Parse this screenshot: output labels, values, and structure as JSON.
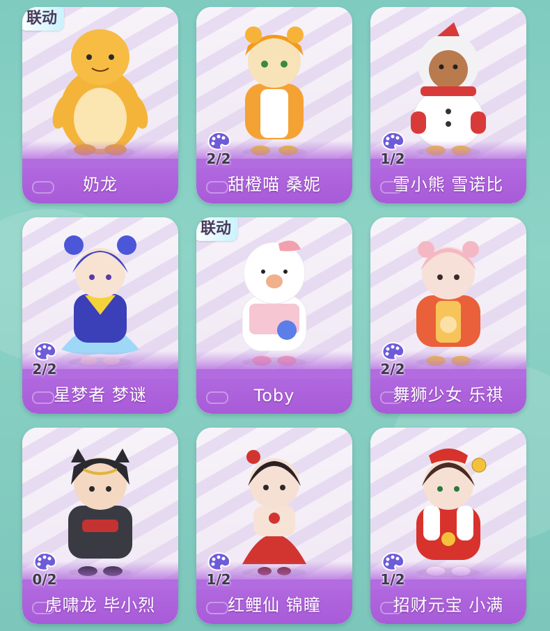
{
  "cards": [
    {
      "name": "奶龙",
      "badge": "联动",
      "count": "",
      "figure": "yellow-dragon",
      "colors": {
        "main": "#f4b43a",
        "belly": "#fbe5b0"
      }
    },
    {
      "name": "甜橙喵 桑妮",
      "badge": "",
      "count": "2/2",
      "figure": "orange-cat-girl",
      "colors": {
        "main": "#f4a233",
        "belly": "#ffffff"
      }
    },
    {
      "name": "雪小熊 雪诺比",
      "badge": "",
      "count": "1/2",
      "figure": "snow-bear",
      "colors": {
        "main": "#ffffff",
        "belly": "#d83a3a"
      }
    },
    {
      "name": "星梦者 梦谜",
      "badge": "",
      "count": "2/2",
      "figure": "star-dreamer",
      "colors": {
        "main": "#3b3fb8",
        "belly": "#9fd8f7"
      }
    },
    {
      "name": "Toby",
      "badge": "联动",
      "count": "",
      "figure": "toby-duck",
      "colors": {
        "main": "#ffffff",
        "belly": "#f6c6d2"
      }
    },
    {
      "name": "舞狮少女 乐祺",
      "badge": "",
      "count": "2/2",
      "figure": "lion-dance-girl",
      "colors": {
        "main": "#e9603a",
        "belly": "#f7c45a"
      }
    },
    {
      "name": "虎啸龙 毕小烈",
      "badge": "",
      "count": "0/2",
      "figure": "tiger-warrior",
      "colors": {
        "main": "#3a3a42",
        "belly": "#c43232"
      }
    },
    {
      "name": "红鲤仙 锦瞳",
      "badge": "",
      "count": "1/2",
      "figure": "koi-fairy",
      "colors": {
        "main": "#d2352f",
        "belly": "#f6e3d6"
      }
    },
    {
      "name": "招财元宝 小满",
      "badge": "",
      "count": "1/2",
      "figure": "fortune-girl",
      "colors": {
        "main": "#d8322c",
        "belly": "#ffffff"
      }
    }
  ]
}
